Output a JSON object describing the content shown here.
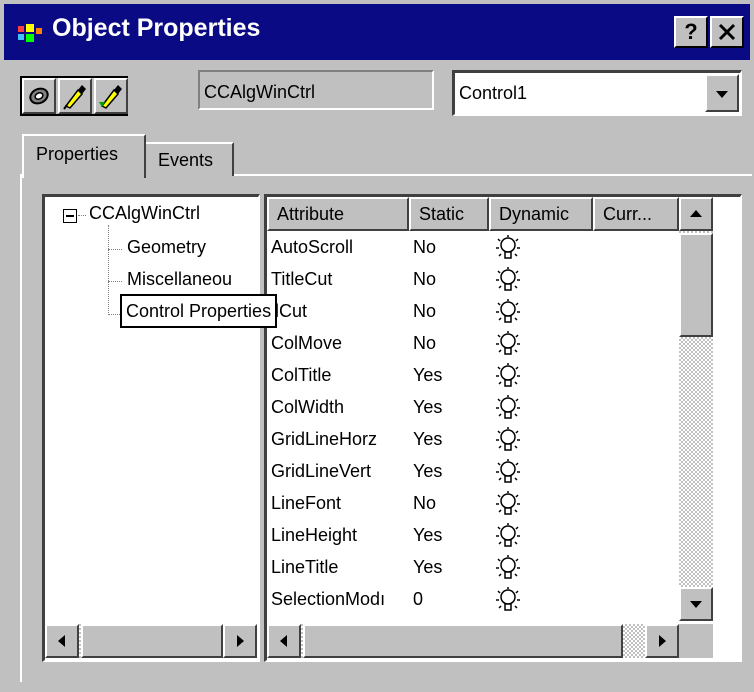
{
  "window": {
    "title": "Object Properties",
    "help_label": "?",
    "close_label": "✕"
  },
  "toolbar": {
    "object_type": "CCAlgWinCtrl",
    "object_name": "Control1"
  },
  "tabs": [
    {
      "label": "Properties",
      "active": true
    },
    {
      "label": "Events",
      "active": false
    }
  ],
  "tree": {
    "root": "CCAlgWinCtrl",
    "expander": "⊟",
    "children": [
      "Geometry",
      "Miscellaneou",
      "Control Properties"
    ],
    "tooltip": "Control Properties"
  },
  "table": {
    "columns": [
      "Attribute",
      "Static",
      "Dynamic",
      "Curr..."
    ],
    "rows": [
      {
        "attribute": "AutoScroll",
        "static": "No",
        "dynamic": "bulb-icon"
      },
      {
        "attribute": "TitleCut",
        "static": "No",
        "dynamic": "bulb-icon"
      },
      {
        "attribute": "llCut",
        "static": "No",
        "dynamic": "bulb-icon"
      },
      {
        "attribute": "ColMove",
        "static": "No",
        "dynamic": "bulb-icon"
      },
      {
        "attribute": "ColTitle",
        "static": "Yes",
        "dynamic": "bulb-icon"
      },
      {
        "attribute": "ColWidth",
        "static": "Yes",
        "dynamic": "bulb-icon"
      },
      {
        "attribute": "GridLineHorz",
        "static": "Yes",
        "dynamic": "bulb-icon"
      },
      {
        "attribute": "GridLineVert",
        "static": "Yes",
        "dynamic": "bulb-icon"
      },
      {
        "attribute": "LineFont",
        "static": "No",
        "dynamic": "bulb-icon"
      },
      {
        "attribute": "LineHeight",
        "static": "Yes",
        "dynamic": "bulb-icon"
      },
      {
        "attribute": "LineTitle",
        "static": "Yes",
        "dynamic": "bulb-icon"
      },
      {
        "attribute": "SelectionModı",
        "static": "0",
        "dynamic": "bulb-icon"
      }
    ]
  },
  "colors": {
    "titlebar": "#0a0a84",
    "face": "#c0c0c0"
  }
}
